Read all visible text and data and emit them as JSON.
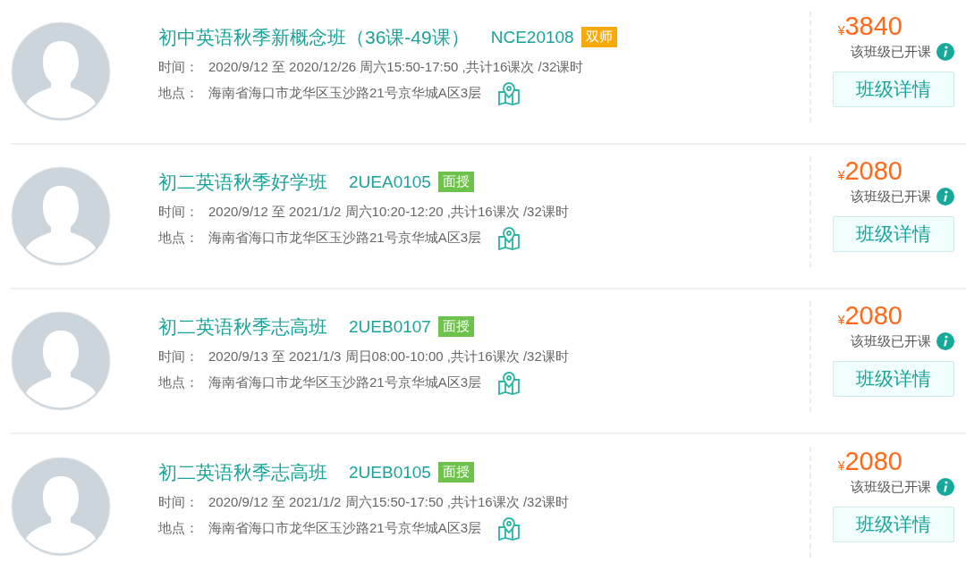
{
  "courses": [
    {
      "title": "初中英语秋季新概念班（36课-49课）",
      "code": "NCE20108",
      "tag": {
        "kind": "dual",
        "label": "双师"
      },
      "time_label": "时间：",
      "time": "2020/9/12 至 2020/12/26 周六15:50-17:50 ,共计16课次 /32课时",
      "place_label": "地点：",
      "place": "海南省海口市龙华区玉沙路21号京华城A区3层",
      "currency": "¥",
      "price": "3840",
      "status": "该班级已开课",
      "button": "班级详情"
    },
    {
      "title": "初二英语秋季好学班",
      "code": "2UEA0105",
      "tag": {
        "kind": "offline",
        "label": "面授"
      },
      "time_label": "时间：",
      "time": "2020/9/12 至 2021/1/2 周六10:20-12:20 ,共计16课次 /32课时",
      "place_label": "地点：",
      "place": "海南省海口市龙华区玉沙路21号京华城A区3层",
      "currency": "¥",
      "price": "2080",
      "status": "该班级已开课",
      "button": "班级详情"
    },
    {
      "title": "初二英语秋季志高班",
      "code": "2UEB0107",
      "tag": {
        "kind": "offline",
        "label": "面授"
      },
      "time_label": "时间：",
      "time": "2020/9/13 至 2021/1/3 周日08:00-10:00 ,共计16课次 /32课时",
      "place_label": "地点：",
      "place": "海南省海口市龙华区玉沙路21号京华城A区3层",
      "currency": "¥",
      "price": "2080",
      "status": "该班级已开课",
      "button": "班级详情"
    },
    {
      "title": "初二英语秋季志高班",
      "code": "2UEB0105",
      "tag": {
        "kind": "offline",
        "label": "面授"
      },
      "time_label": "时间：",
      "time": "2020/9/12 至 2021/1/2 周六15:50-17:50 ,共计16课次 /32课时",
      "place_label": "地点：",
      "place": "海南省海口市龙华区玉沙路21号京华城A区3层",
      "currency": "¥",
      "price": "2080",
      "status": "该班级已开课",
      "button": "班级详情"
    }
  ]
}
